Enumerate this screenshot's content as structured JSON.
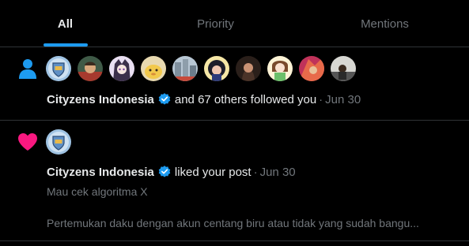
{
  "tabs": [
    {
      "label": "All",
      "active": true
    },
    {
      "label": "Priority",
      "active": false
    },
    {
      "label": "Mentions",
      "active": false
    }
  ],
  "colors": {
    "accent": "#1d9bf0",
    "like": "#f91880",
    "secondary_text": "#71767b",
    "border": "#2f3336"
  },
  "notifications": [
    {
      "type": "follow",
      "icon": "person-icon",
      "name": "Cityzens Indonesia",
      "action": "and 67 others followed you",
      "separator": "·",
      "time": "Jun 30",
      "avatar_count": 10
    },
    {
      "type": "like",
      "icon": "heart-icon",
      "name": "Cityzens Indonesia",
      "action": "liked your post",
      "separator": "·",
      "time": "Jun 30",
      "post_title": "Mau cek algoritma X",
      "post_preview": "Pertemukan daku dengan akun centang biru atau tidak yang sudah bangu..."
    }
  ]
}
